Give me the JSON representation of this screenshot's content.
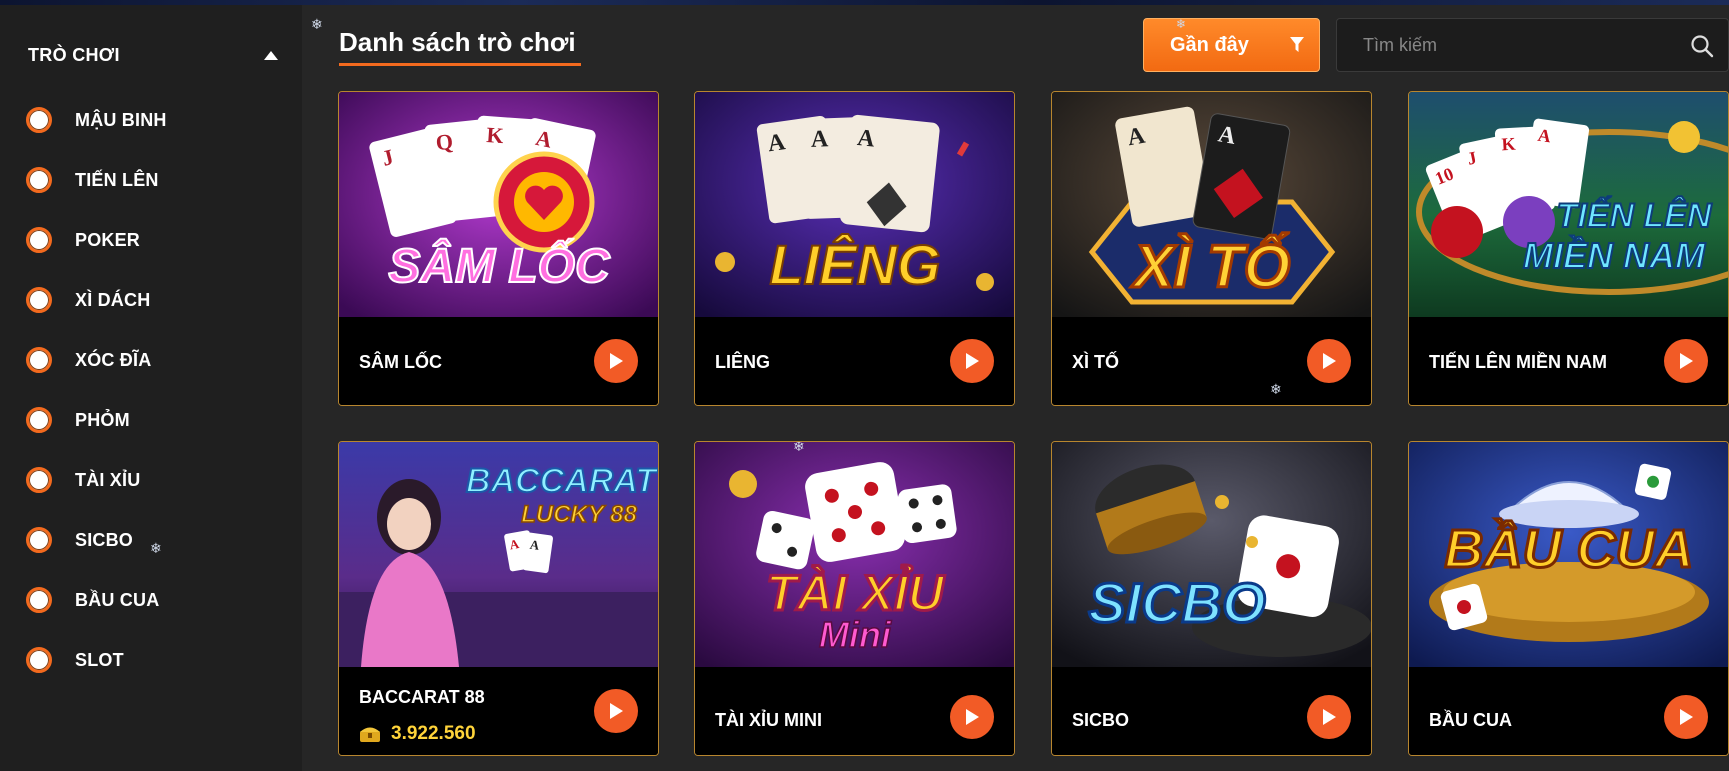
{
  "sidebar": {
    "title": "TRÒ CHƠI",
    "items": [
      {
        "label": "MẬU BINH"
      },
      {
        "label": "TIẾN LÊN"
      },
      {
        "label": "POKER"
      },
      {
        "label": "XÌ DÁCH"
      },
      {
        "label": "XÓC ĐĨA"
      },
      {
        "label": "PHỎM"
      },
      {
        "label": "TÀI XỈU"
      },
      {
        "label": "SICBO"
      },
      {
        "label": "BẦU CUA"
      },
      {
        "label": "SLOT"
      }
    ]
  },
  "header": {
    "title": "Danh sách trò chơi",
    "filter_label": "Gần đây",
    "search_placeholder": "Tìm kiếm"
  },
  "games": [
    {
      "name": "SÂM LỐC",
      "art_text": "SÂM LỐC"
    },
    {
      "name": "LIÊNG",
      "art_text": "LIÊNG"
    },
    {
      "name": "XÌ TỐ",
      "art_text": "XÌ TỐ"
    },
    {
      "name": "TIẾN LÊN MIỀN NAM",
      "art_text_1": "TIẾN LÊN",
      "art_text_2": "MIỀN NAM"
    },
    {
      "name": "BACCARAT 88",
      "art_text_1": "BACCARAT",
      "art_text_2": "LUCKY 88",
      "jackpot": "3.922.560"
    },
    {
      "name": "TÀI XỈU MINI",
      "art_text_1": "TÀI XỈU",
      "art_text_2": "Mini"
    },
    {
      "name": "SICBO",
      "art_text": "SICBO"
    },
    {
      "name": "BẦU CUA",
      "art_text": "BẦU CUA"
    }
  ],
  "colors": {
    "accent": "#f36a1e",
    "card_border": "#b8862e",
    "jackpot": "#ffd43a"
  }
}
